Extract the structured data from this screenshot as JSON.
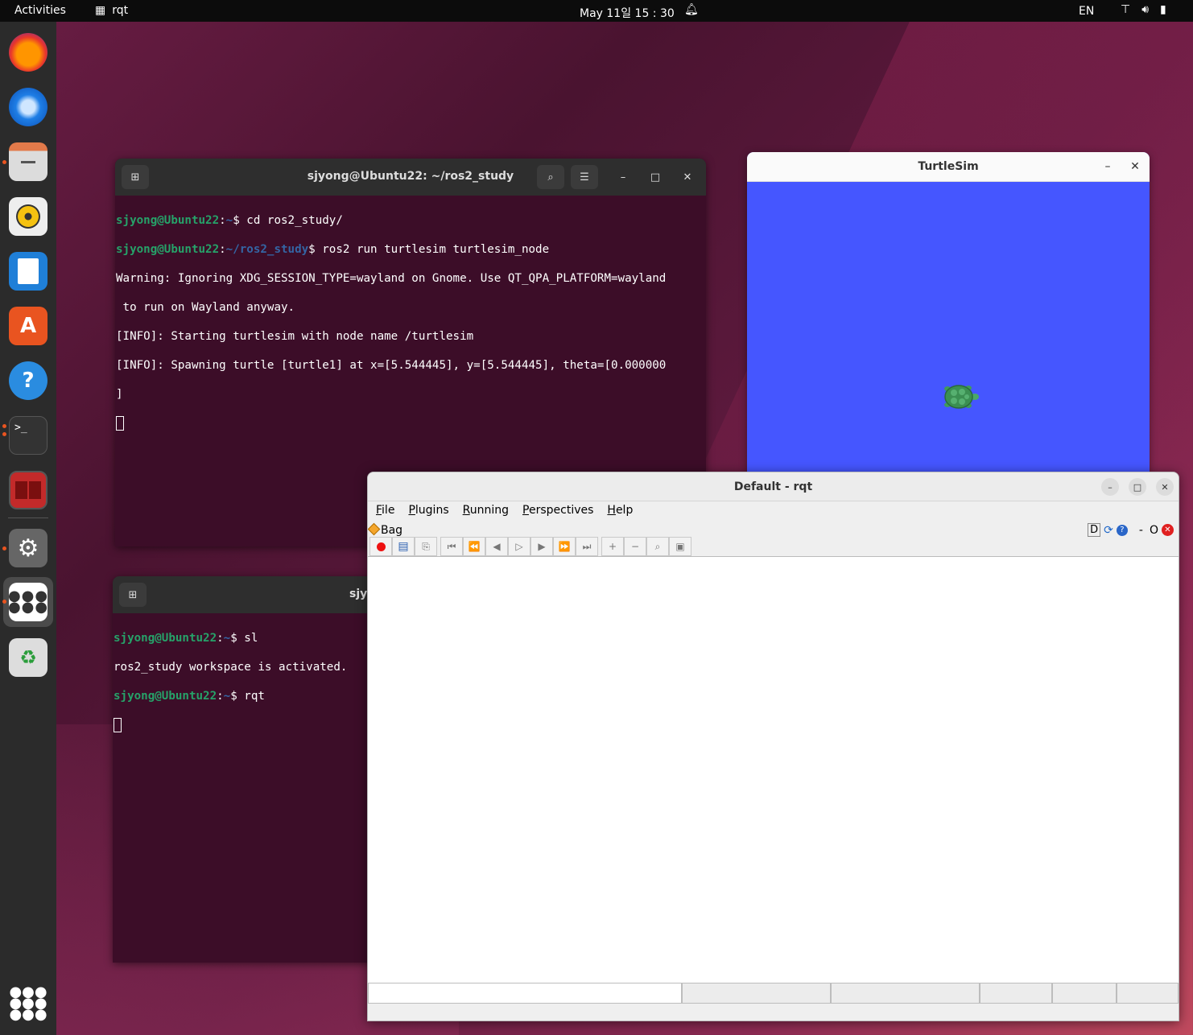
{
  "topbar": {
    "activities": "Activities",
    "app": "rqt",
    "clock": "May 11일  15 : 30",
    "lang": "EN"
  },
  "dock": {
    "items": [
      "firefox-icon",
      "thunderbird-icon",
      "files-icon",
      "rhythmbox-icon",
      "writer-icon",
      "software-icon",
      "help-icon",
      "terminal-icon",
      "terminator-icon",
      "settings-icon",
      "app-grid-icon",
      "trash-icon"
    ]
  },
  "terminal1": {
    "title": "sjyong@Ubuntu22: ~/ros2_study",
    "lines": [
      {
        "user": "sjyong@Ubuntu22",
        "sep": ":",
        "path": "~",
        "cmd": "$ cd ros2_study/"
      },
      {
        "user": "sjyong@Ubuntu22",
        "sep": ":",
        "path": "~/ros2_study",
        "cmd": "$ ros2 run turtlesim turtlesim_node"
      },
      {
        "text": "Warning: Ignoring XDG_SESSION_TYPE=wayland on Gnome. Use QT_QPA_PLATFORM=wayland"
      },
      {
        "text": " to run on Wayland anyway."
      },
      {
        "text": "[INFO]: Starting turtlesim with node name /turtlesim"
      },
      {
        "text": "[INFO]: Spawning turtle [turtle1] at x=[5.544445], y=[5.544445], theta=[0.000000"
      },
      {
        "text": "]"
      }
    ]
  },
  "terminal2": {
    "title": "sjy",
    "lines": [
      {
        "user": "sjyong@Ubuntu22",
        "sep": ":",
        "path": "~",
        "cmd": "$ sl"
      },
      {
        "text": "ros2_study workspace is activated."
      },
      {
        "user": "sjyong@Ubuntu22",
        "sep": ":",
        "path": "~",
        "cmd": "$ rqt"
      }
    ]
  },
  "turtlesim": {
    "title": "TurtleSim",
    "background": "#4556ff"
  },
  "rqt": {
    "title": "Default - rqt",
    "menu": [
      {
        "first": "F",
        "rest": "ile"
      },
      {
        "first": "P",
        "rest": "lugins"
      },
      {
        "first": "R",
        "rest": "unning"
      },
      {
        "first": "P",
        "rest": "erspectives"
      },
      {
        "first": "H",
        "rest": "elp"
      }
    ],
    "plugin": "Bag",
    "plugin_right": {
      "d": "D",
      "dash": "-",
      "o": "O"
    }
  }
}
